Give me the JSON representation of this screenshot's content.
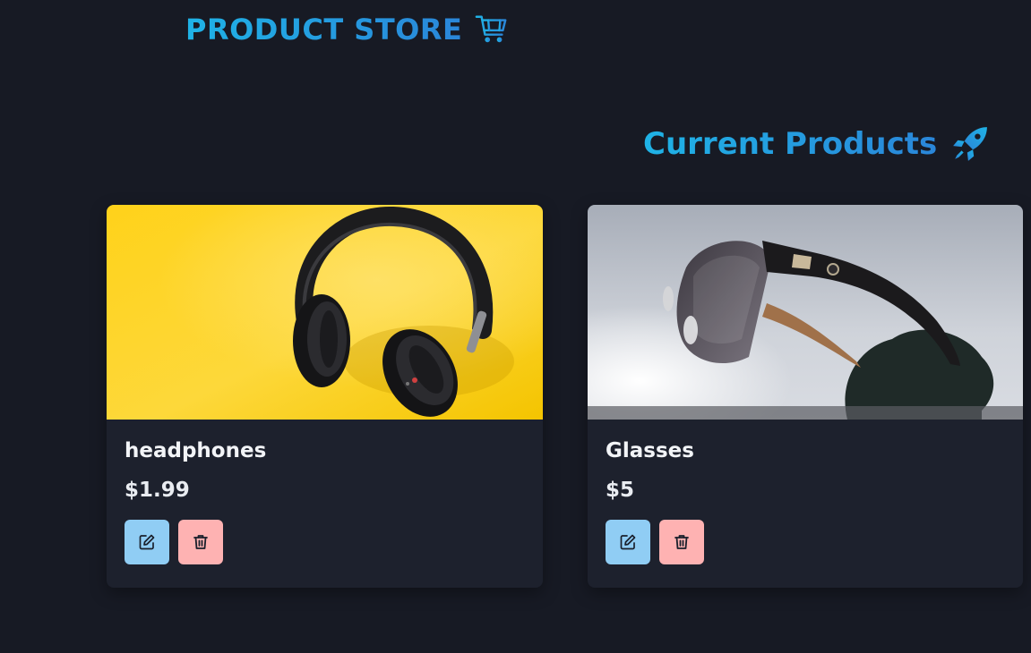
{
  "navbar": {
    "brand_label": "PRODUCT STORE",
    "brand_icon": "shopping-cart-icon"
  },
  "main": {
    "section_title": "Current Products",
    "section_icon": "rocket-icon",
    "products": [
      {
        "name": "headphones",
        "price": "$1.99",
        "image": "headphones-photo",
        "edit_icon": "edit-icon",
        "delete_icon": "trash-icon"
      },
      {
        "name": "Glasses",
        "price": "$5",
        "image": "sunglasses-photo",
        "edit_icon": "edit-icon",
        "delete_icon": "trash-icon"
      }
    ]
  },
  "colors": {
    "background": "#171a24",
    "card": "#1d212d",
    "accent_gradient_start": "#1fb3e6",
    "accent_gradient_end": "#2a86d9",
    "edit_button": "#90cdf4",
    "delete_button": "#feb2b2"
  }
}
